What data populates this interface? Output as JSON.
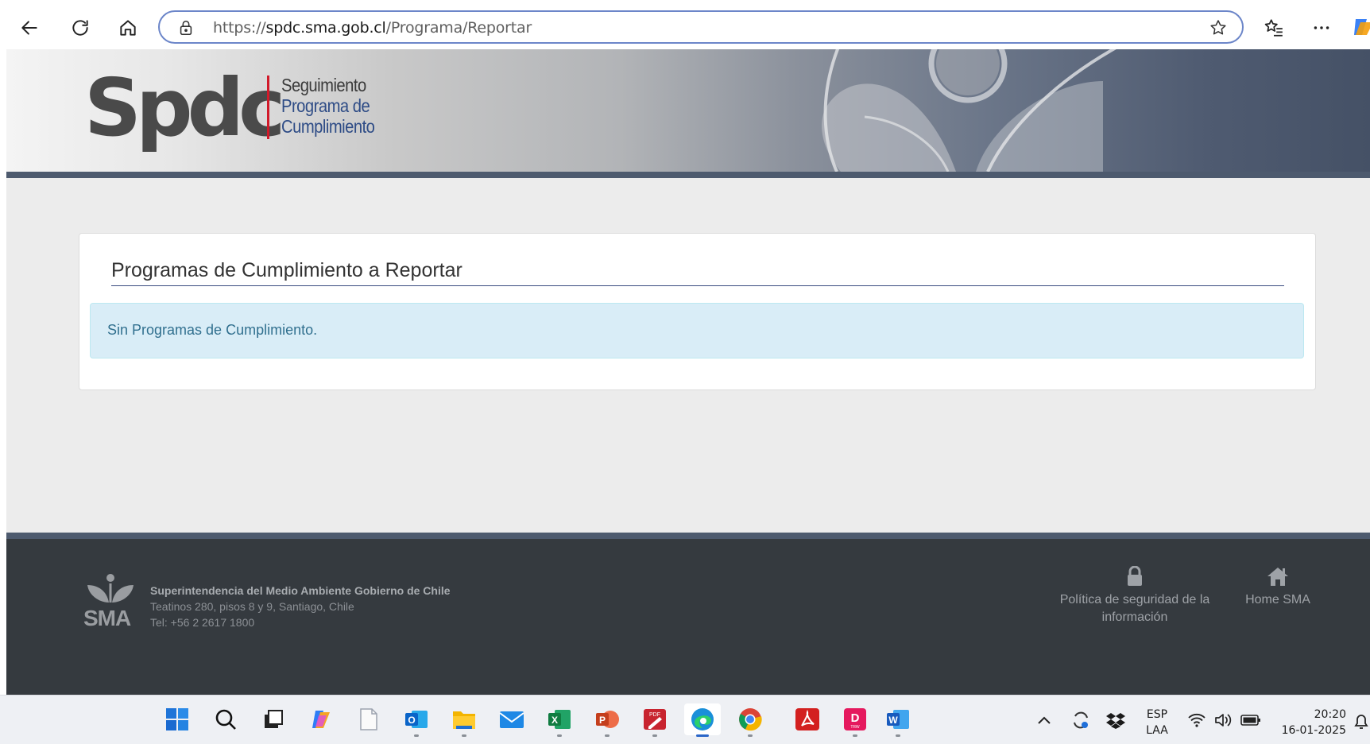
{
  "browser": {
    "url_scheme": "https://",
    "url_host": "spdc.sma.gob.cl",
    "url_path": "/Programa/Reportar"
  },
  "header": {
    "logo_word": "Spdc",
    "logo_lines": [
      "Seguimiento",
      "Programa de",
      "Cumplimiento"
    ]
  },
  "main": {
    "title": "Programas de Cumplimiento a Reportar",
    "alert_text": "Sin Programas de Cumplimiento."
  },
  "footer": {
    "logo_text": "SMA",
    "org_name": "Superintendencia del Medio Ambiente Gobierno de Chile",
    "address": "Teatinos 280, pisos 8 y 9, Santiago, Chile",
    "phone": "Tel: +56 2 2617 1800",
    "links": [
      {
        "label": "Política de seguridad de la información",
        "icon": "lock-icon"
      },
      {
        "label": "Home SMA",
        "icon": "home-icon"
      }
    ]
  },
  "taskbar": {
    "apps": [
      "start",
      "search",
      "task-view",
      "copilot",
      "notepad",
      "outlook",
      "file-explorer",
      "mail",
      "excel",
      "powerpoint",
      "pdf-editor",
      "edge",
      "chrome",
      "acrobat",
      "dtrw",
      "word"
    ],
    "active_app": "edge",
    "language_line1": "ESP",
    "language_line2": "LAA",
    "time": "20:20",
    "date": "16-01-2025"
  },
  "colors": {
    "accent_stripe": "#4d5a6e",
    "footer_bg": "#353a3f",
    "alert_bg": "#d9edf7",
    "alert_text": "#31708f",
    "logo_red": "#d11a2a",
    "logo_blue": "#2e4c86"
  }
}
